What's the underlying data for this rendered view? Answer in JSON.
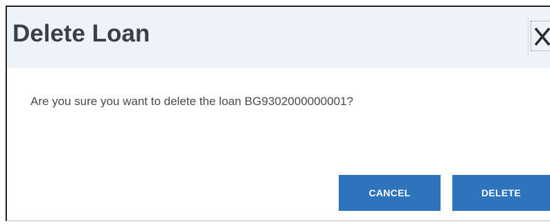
{
  "dialog": {
    "title": "Delete Loan",
    "close_icon": "close-icon",
    "message": "Are you sure you want to delete the loan BG9302000000001?",
    "buttons": {
      "cancel_label": "CANCEL",
      "delete_label": "DELETE"
    }
  },
  "colors": {
    "header_background": "#eef2f9",
    "title_text": "#3b3f46",
    "primary_button": "#2e74bd",
    "button_text": "#ffffff",
    "message_text": "#4a4a4a"
  }
}
